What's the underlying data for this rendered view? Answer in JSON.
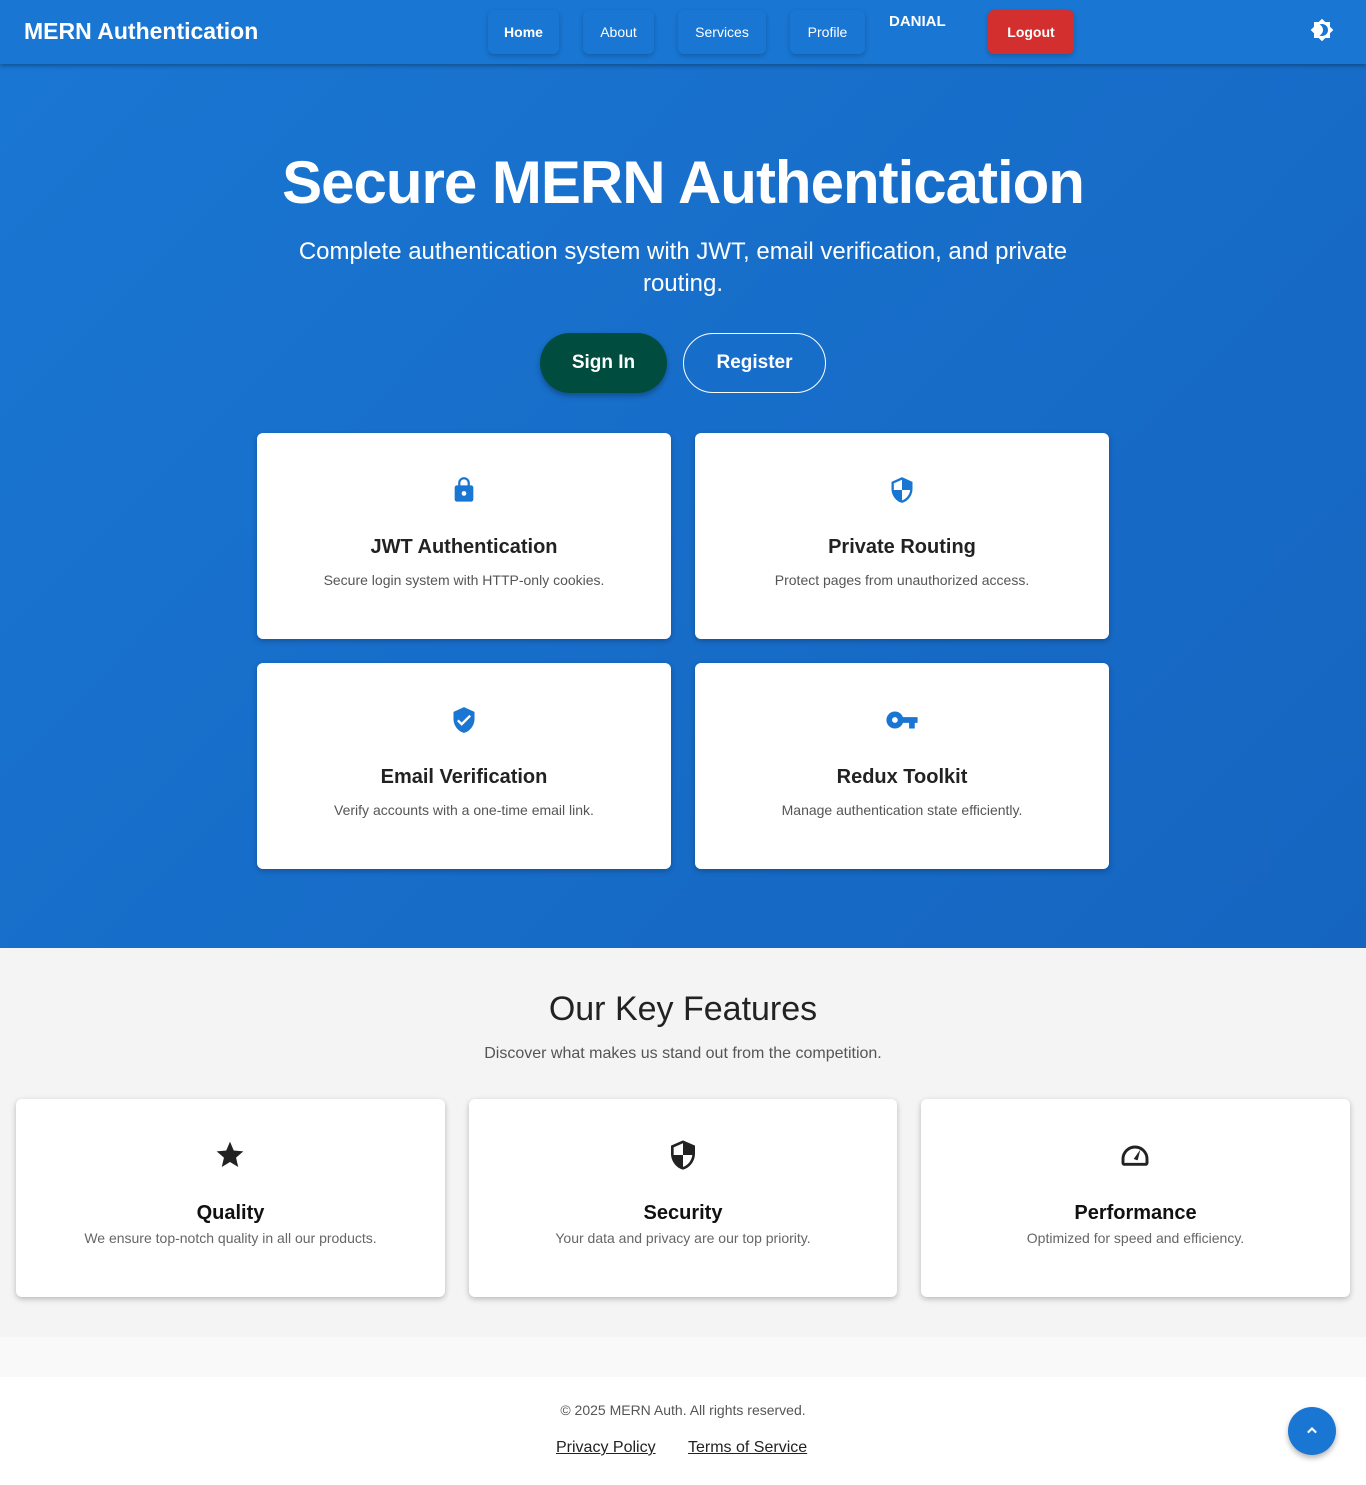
{
  "nav": {
    "brand": "MERN Authentication",
    "items": [
      "Home",
      "About",
      "Services",
      "Profile"
    ],
    "user": "DANIAL",
    "logout": "Logout",
    "theme_icon": "brightness-icon",
    "color": "#1976d2"
  },
  "hero": {
    "title": "Secure MERN Authentication",
    "subtitle": "Complete authentication system with JWT, email verification, and private routing.",
    "signin": "Sign In",
    "register": "Register",
    "cards": [
      {
        "icon": "lock-icon",
        "title": "JWT Authentication",
        "desc": "Secure login system with HTTP-only cookies."
      },
      {
        "icon": "shield-icon",
        "title": "Private Routing",
        "desc": "Protect pages from unauthorized access."
      },
      {
        "icon": "verified-icon",
        "title": "Email Verification",
        "desc": "Verify accounts with a one-time email link."
      },
      {
        "icon": "key-icon",
        "title": "Redux Toolkit",
        "desc": "Manage authentication state efficiently."
      }
    ]
  },
  "features": {
    "title": "Our Key Features",
    "subtitle": "Discover what makes us stand out from the competition.",
    "cards": [
      {
        "icon": "star-icon",
        "title": "Quality",
        "desc": "We ensure top-notch quality in all our products."
      },
      {
        "icon": "shield-icon",
        "title": "Security",
        "desc": "Your data and privacy are our top priority."
      },
      {
        "icon": "speed-icon",
        "title": "Performance",
        "desc": "Optimized for speed and efficiency."
      }
    ]
  },
  "footer": {
    "copyright": "© 2025 MERN Auth. All rights reserved.",
    "links": [
      "Privacy Policy",
      "Terms of Service"
    ]
  }
}
